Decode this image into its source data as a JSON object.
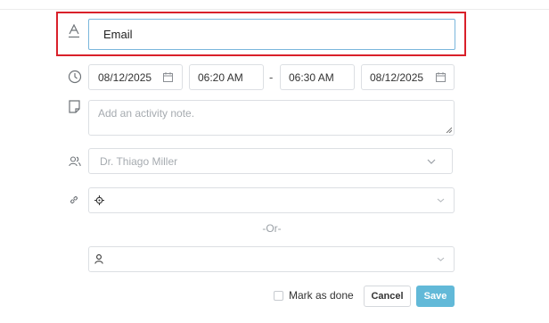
{
  "form": {
    "title_value": "Email",
    "start_date": "08/12/2025",
    "start_time": "06:20 AM",
    "separator": "-",
    "end_time": "06:30 AM",
    "end_date": "08/12/2025",
    "note_placeholder": "Add an activity note.",
    "assignee_value": "Dr. Thiago Miller",
    "or_label": "-Or-",
    "mark_done_label": "Mark as done",
    "cancel_label": "Cancel",
    "save_label": "Save"
  },
  "colors": {
    "highlight": "#d9202a",
    "primary": "#62b9d8",
    "focus_border": "#7ab6dc"
  },
  "icons": [
    "text-type-icon",
    "clock-icon",
    "note-icon",
    "users-icon",
    "link-icon",
    "calendar-icon",
    "chevron-down-icon",
    "crosshair-icon",
    "person-icon"
  ]
}
